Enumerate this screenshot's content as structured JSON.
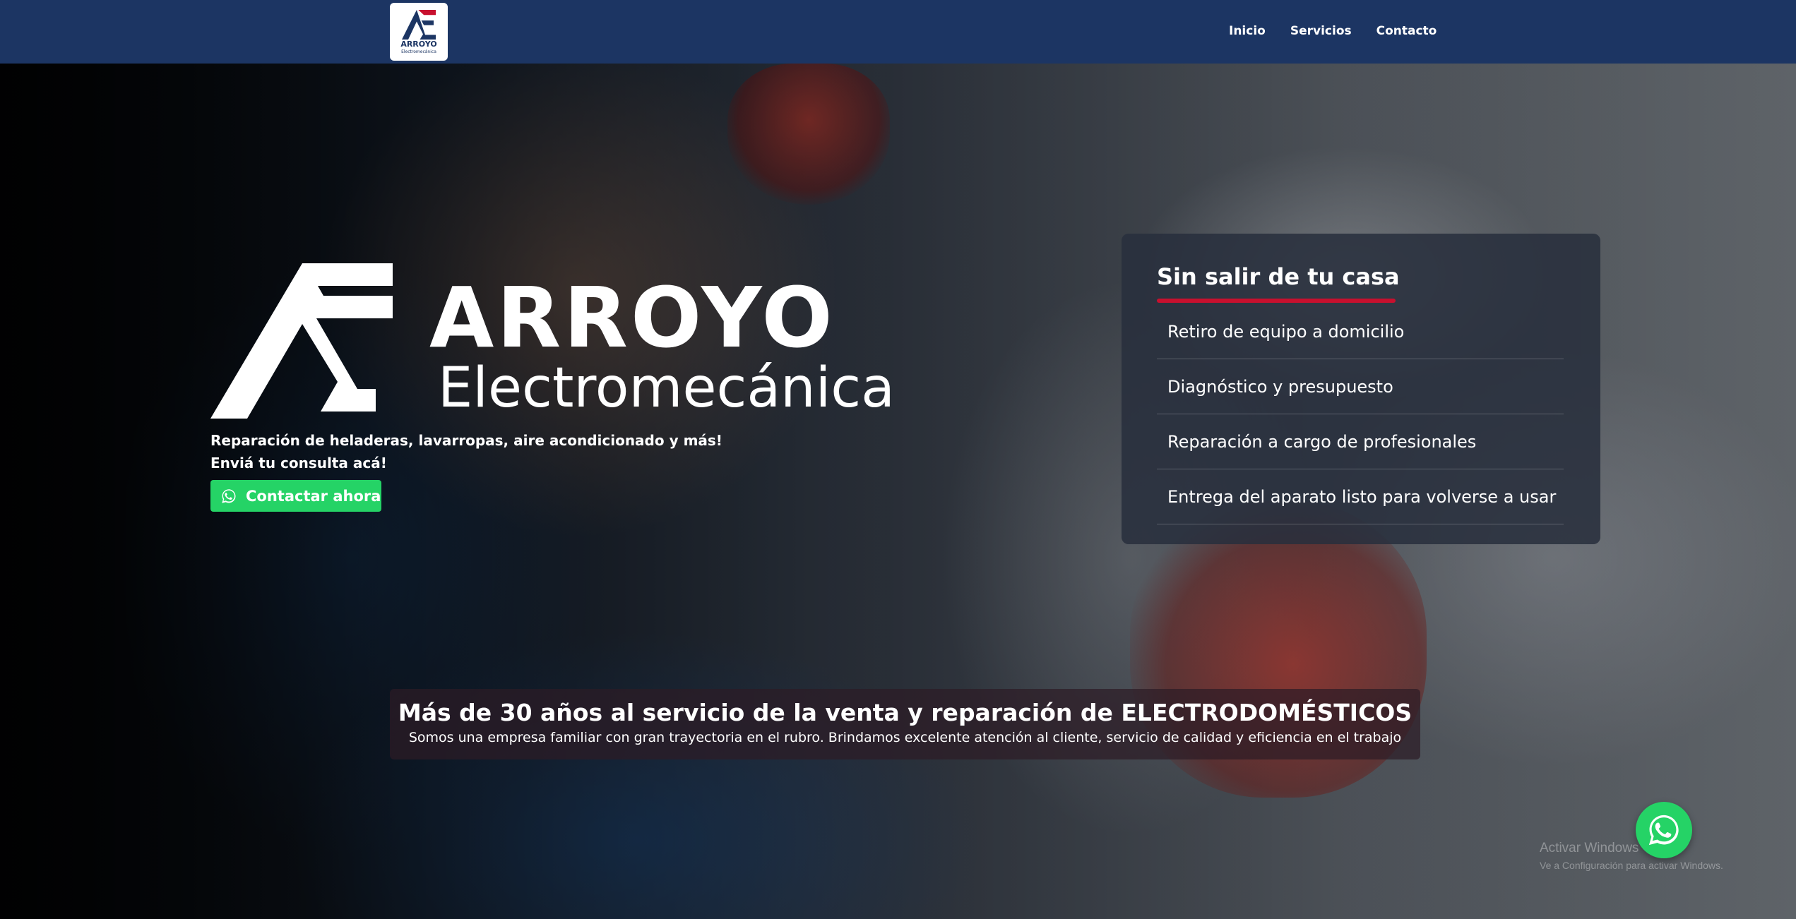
{
  "nav": {
    "logo_title": "ARROYO",
    "logo_subtitle": "Electromecánica",
    "links": [
      "Inicio",
      "Servicios",
      "Contacto"
    ]
  },
  "hero": {
    "brand_name": "ARROYO",
    "brand_sub": "Electromecánica",
    "tagline_1": "Reparación de heladeras, lavarropas, aire acondicionado y más!",
    "tagline_2": "Enviá tu consulta acá!",
    "cta_label": "Contactar ahora"
  },
  "card": {
    "title": "Sin salir de tu casa",
    "items": [
      "Retiro de equipo a domicilio",
      "Diagnóstico y presupuesto",
      "Reparación a cargo de profesionales",
      "Entrega del aparato listo para volverse a usar"
    ]
  },
  "banner": {
    "title": "Más de 30 años al servicio de la venta y reparación de ELECTRODOMÉSTICOS",
    "subtitle": "Somos una empresa familiar con gran trayectoria en el rubro. Brindamos excelente atención al cliente, servicio de calidad y eficiencia en el trabajo"
  },
  "watermark": {
    "line1": "Activar Windows",
    "line2": "Ve a Configuración para activar Windows."
  },
  "colors": {
    "navbar": "#1c3563",
    "accent_red": "#c8102e",
    "whatsapp_green": "#25d366"
  },
  "icons": [
    "logo-mark-icon",
    "whatsapp-icon"
  ]
}
